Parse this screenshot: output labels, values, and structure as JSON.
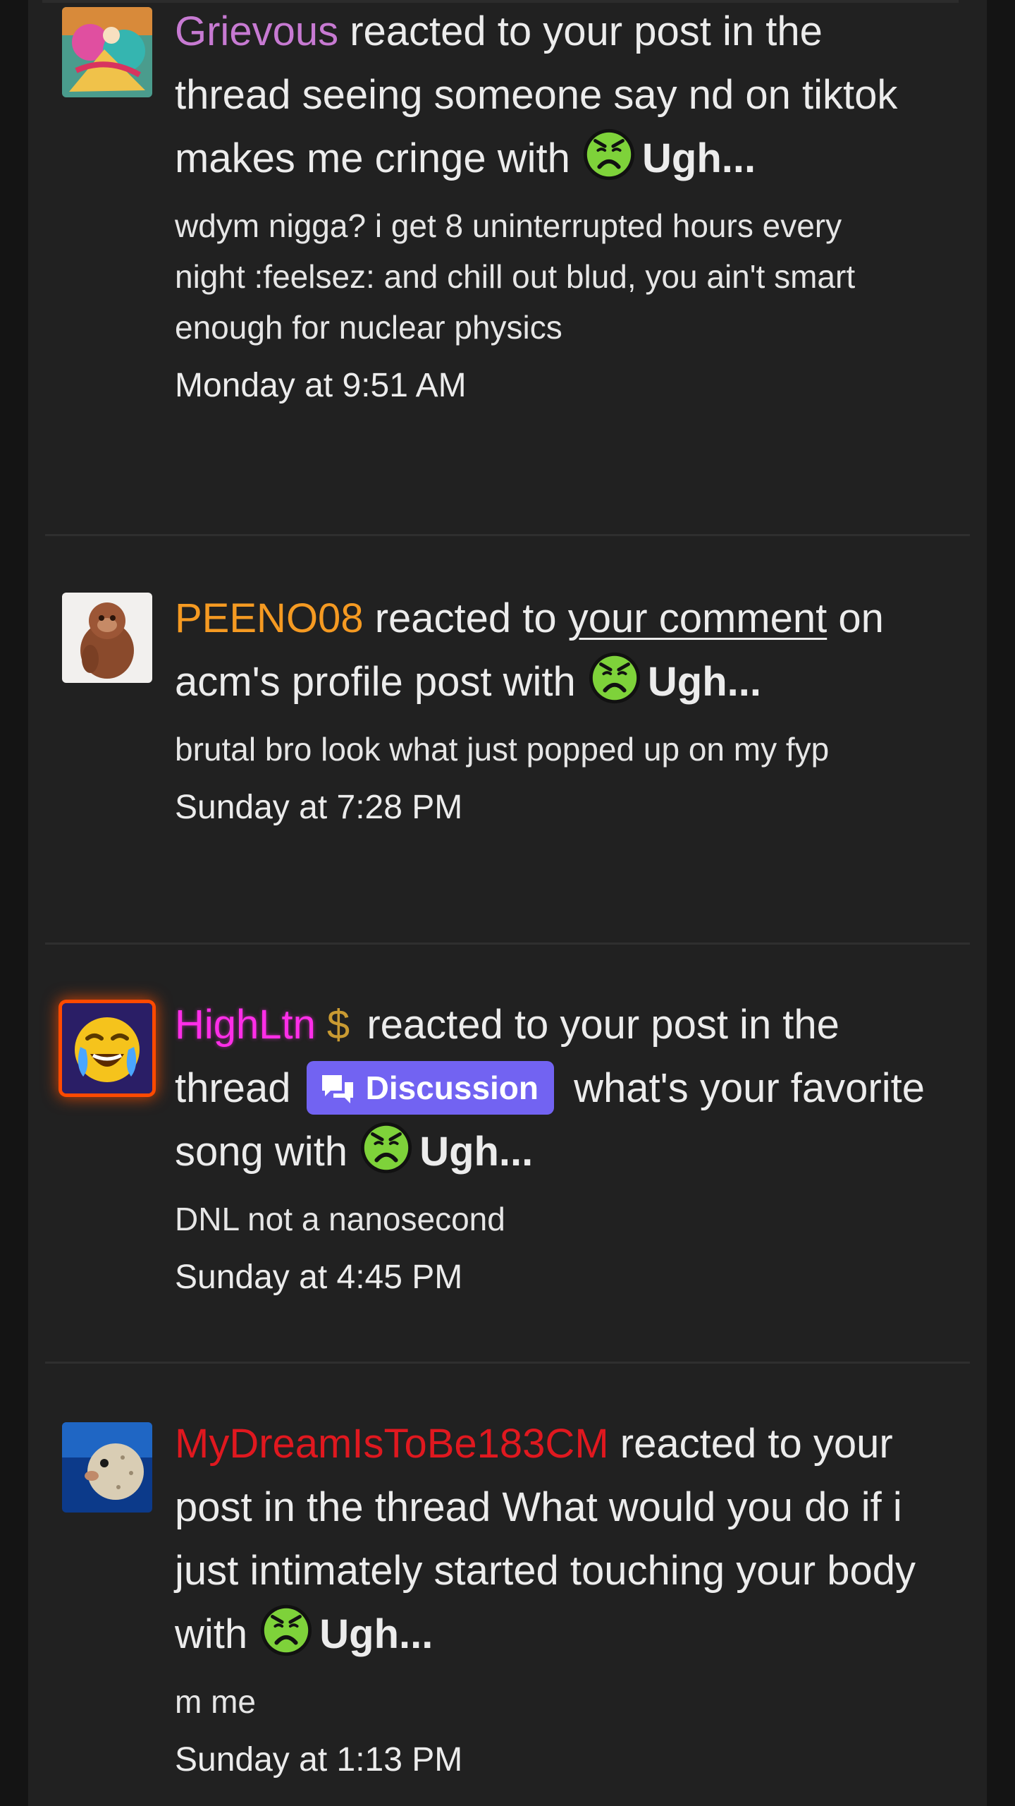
{
  "alerts": [
    {
      "username": "Grievous",
      "action": "reacted to your post in the thread",
      "target": "seeing someone say nd on tiktok makes me cringe",
      "with": "with",
      "reaction": "Ugh...",
      "snippet": "wdym nigga? i get 8 uninterrupted hours every night :feelsez: and chill out blud, you ain't smart enough for nuclear physics",
      "time": "Monday at 9:51 AM"
    },
    {
      "username": "PEENO08",
      "action": "reacted to",
      "link": "your comment",
      "target": "on acm's profile post",
      "with": "with",
      "reaction": "Ugh...",
      "snippet": "brutal bro look what just popped up on my fyp",
      "time": "Sunday at 7:28 PM"
    },
    {
      "username": "HighLtn",
      "username_icon": "dollar-sign-icon",
      "action": "reacted to your post in the thread",
      "prefix": "Discussion",
      "target": "what's your favorite song",
      "with": "with",
      "reaction": "Ugh...",
      "snippet": "DNL not a nanosecond",
      "time": "Sunday at 4:45 PM"
    },
    {
      "username": "MyDreamIsToBe183CM",
      "action": "reacted to your post in the thread",
      "target": "What would you do if i just intimately started touching your body",
      "with": "with",
      "reaction": "Ugh...",
      "snippet": "m me",
      "time": "Sunday at 1:13 PM"
    }
  ],
  "colors": {
    "background": "#141414",
    "panel": "#212121",
    "text": "#ececec",
    "grievous": "#c77ad2",
    "peeno": "#f59a22",
    "highltn": "#ff2ee8",
    "mydream": "#e0181f",
    "prefix_badge": "#7263f2",
    "reaction_face": "#7ed23a"
  },
  "icons": {
    "reaction": "nauseated-face-icon",
    "prefix": "comments-icon",
    "dollar": "dollar-sign-icon"
  }
}
